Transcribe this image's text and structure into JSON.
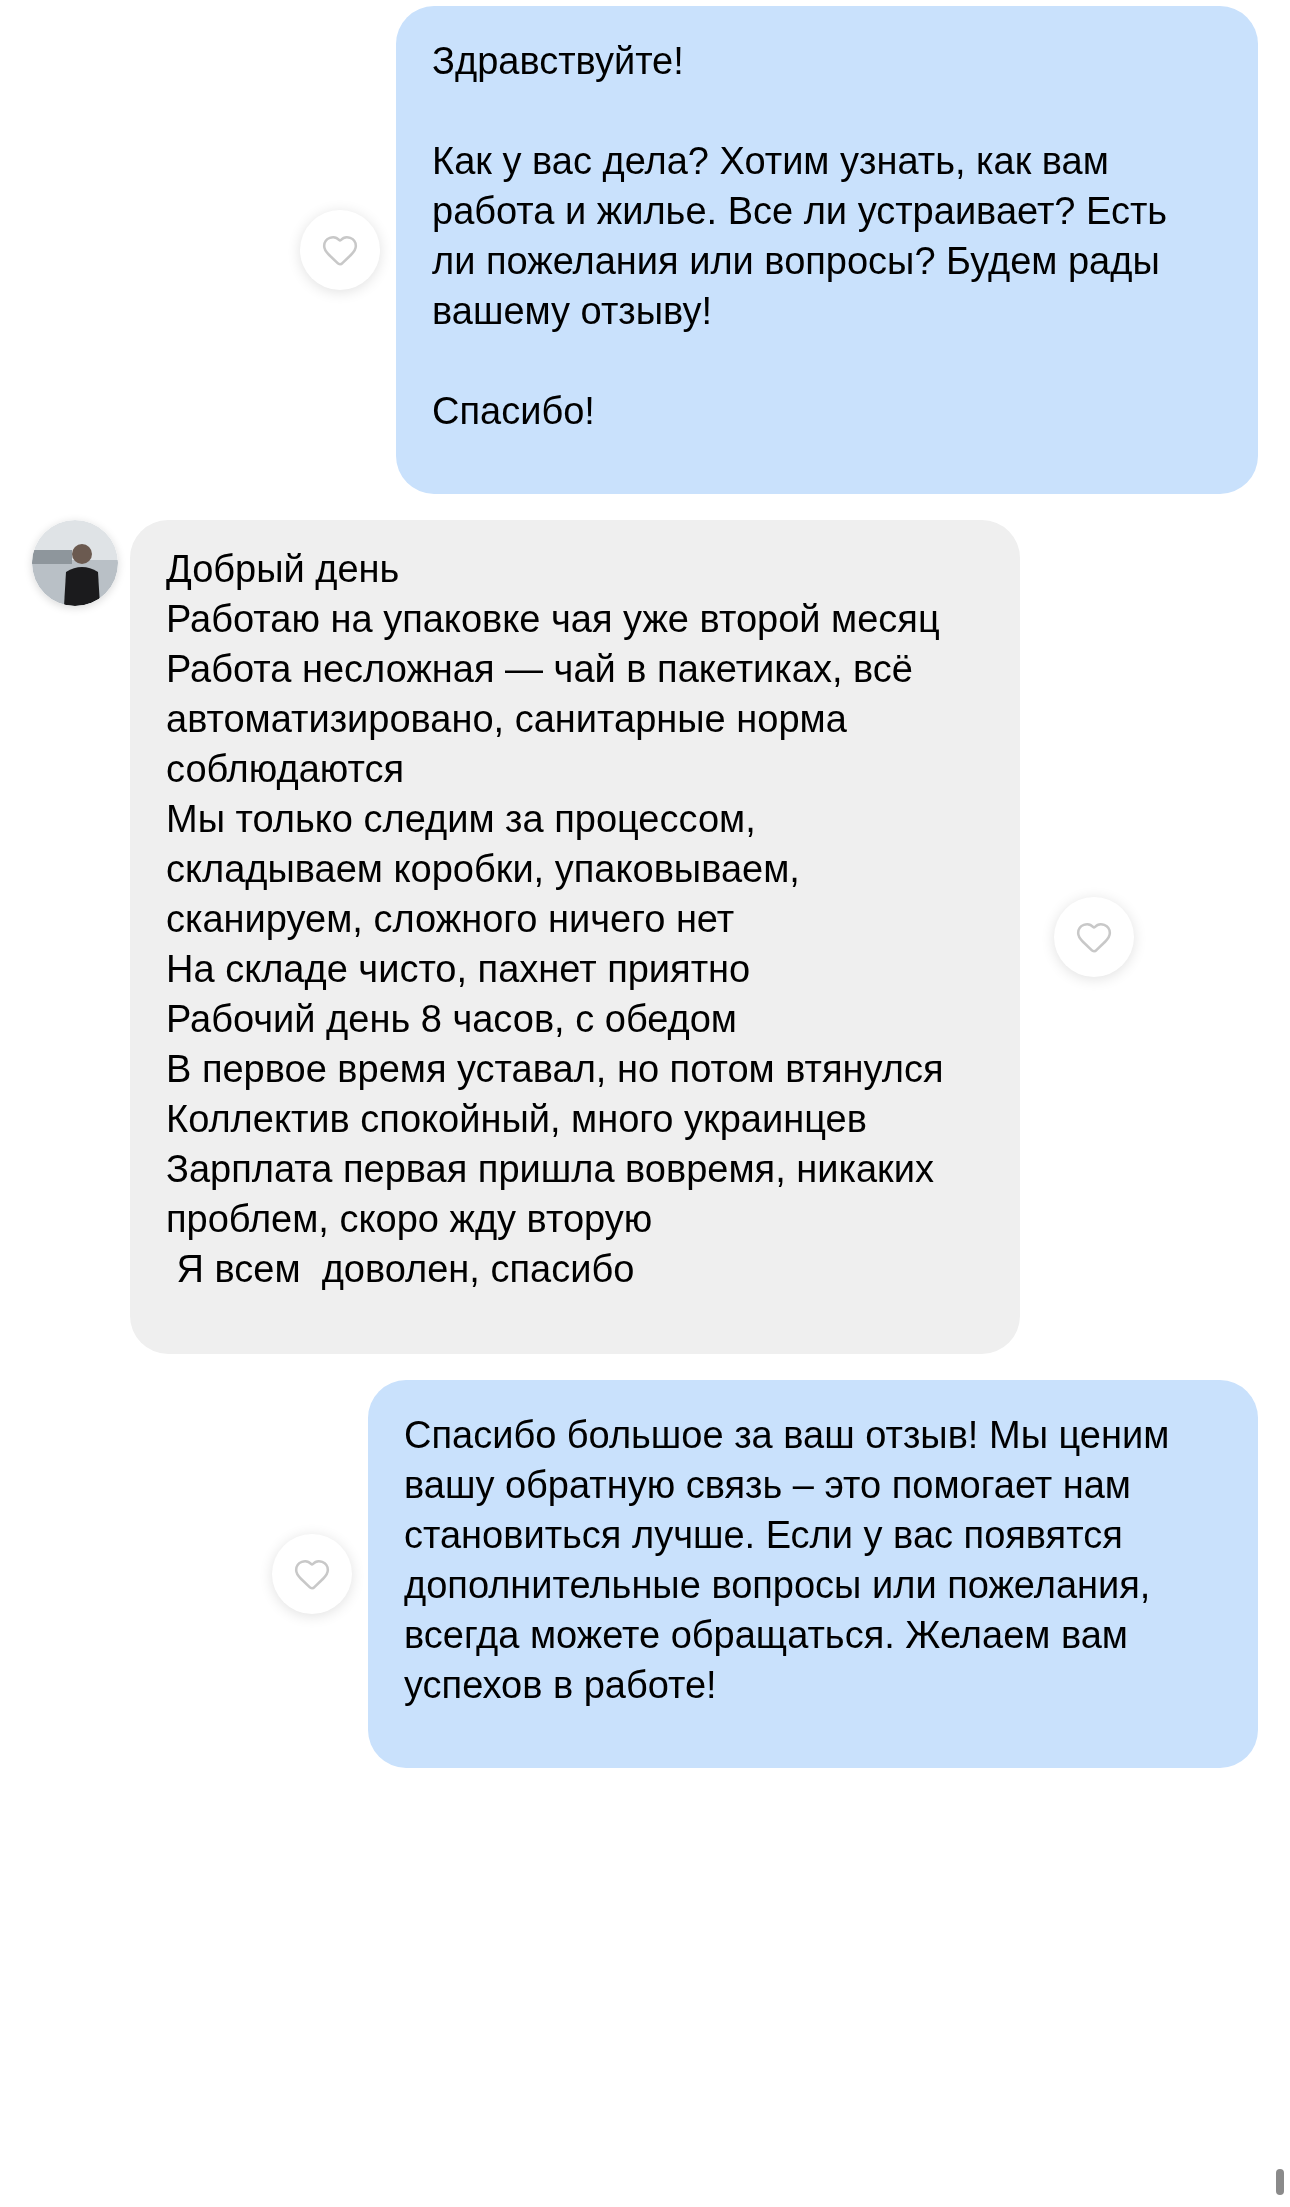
{
  "messages": [
    {
      "kind": "outgoing",
      "paragraphs": [
        "Здравствуйте!",
        "Как у вас дела? Хотим узнать, как вам работа и жилье. Все ли устраивает? Есть ли пожелания или вопросы? Будем рады вашему отзыву!",
        "Спасибо!"
      ]
    },
    {
      "kind": "incoming",
      "lines": [
        "Добрый день",
        "Работаю на упаковке чая уже второй месяц",
        "Работа несложная — чай в пакетиках, всё автоматизировано, санитарные норма соблюдаются",
        "Мы только следим за процессом, складываем коробки, упаковываем, сканируем, сложного ничего нет",
        "На складе чисто, пахнет приятно",
        "Рабочий день 8 часов, с обедом",
        "В первое время уставал, но потом втянулся",
        "Коллектив спокойный, много украинцев",
        "Зарплата первая пришла вовремя, никаких проблем, скоро жду вторую",
        " Я всем  доволен, спасибо"
      ]
    },
    {
      "kind": "outgoing",
      "paragraphs": [
        "Спасибо большое за ваш отзыв! Мы ценим вашу обратную связь – это помогает нам становиться лучше. Если у вас появятся дополнительные вопросы или пожелания, всегда можете обращаться. Желаем вам успехов в работе!"
      ]
    }
  ]
}
